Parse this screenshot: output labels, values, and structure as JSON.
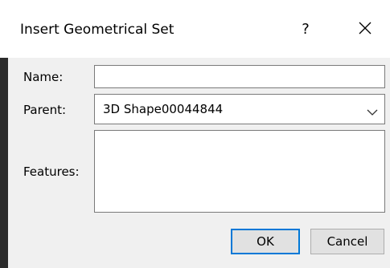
{
  "window": {
    "title": "Insert Geometrical Set",
    "help_label": "?",
    "close_icon": "close-icon"
  },
  "form": {
    "name_label": "Name:",
    "name_value": "",
    "parent_label": "Parent:",
    "parent_value": "3D Shape00044844",
    "features_label": "Features:"
  },
  "buttons": {
    "ok_label": "OK",
    "cancel_label": "Cancel"
  },
  "colors": {
    "titlebar_bg": "#ffffff",
    "dialog_bg": "#f0f0f0",
    "default_button_border": "#0078d7"
  }
}
